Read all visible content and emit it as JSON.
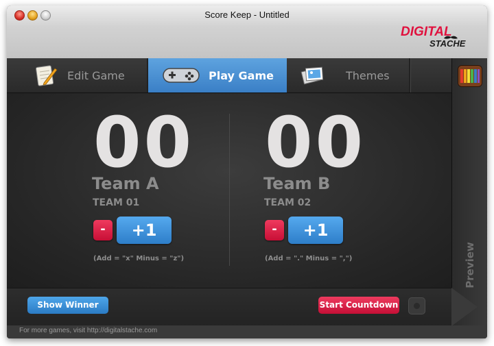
{
  "window": {
    "title": "Score Keep - Untitled"
  },
  "brand": {
    "line1": "DIGITAL",
    "line2": "STACHE",
    "color": "#e0113e"
  },
  "tabs": [
    {
      "label": "Edit Game",
      "icon": "notepad-pencil-icon",
      "active": false
    },
    {
      "label": "Play Game",
      "icon": "gamepad-icon",
      "active": true
    },
    {
      "label": "Themes",
      "icon": "photo-stack-icon",
      "active": false
    }
  ],
  "sidebar": {
    "palette_icon": "color-palette-icon",
    "preview_label": "Preview"
  },
  "teams": [
    {
      "score": "00",
      "name": "Team A",
      "id": "TEAM 01",
      "minus_label": "-",
      "plus_label": "+1",
      "hint": "(Add = \"x\" Minus = \"z\")"
    },
    {
      "score": "00",
      "name": "Team B",
      "id": "TEAM 02",
      "minus_label": "-",
      "plus_label": "+1",
      "hint": "(Add = \".\" Minus = \",\")"
    }
  ],
  "bottom": {
    "show_winner_label": "Show Winner",
    "start_countdown_label": "Start Countdown"
  },
  "footer": {
    "text": "For more games, visit http://digitalstache.com"
  },
  "colors": {
    "accent_blue": "#3a7fc6",
    "accent_red": "#c70f36",
    "score_text": "#e4e2e2"
  }
}
